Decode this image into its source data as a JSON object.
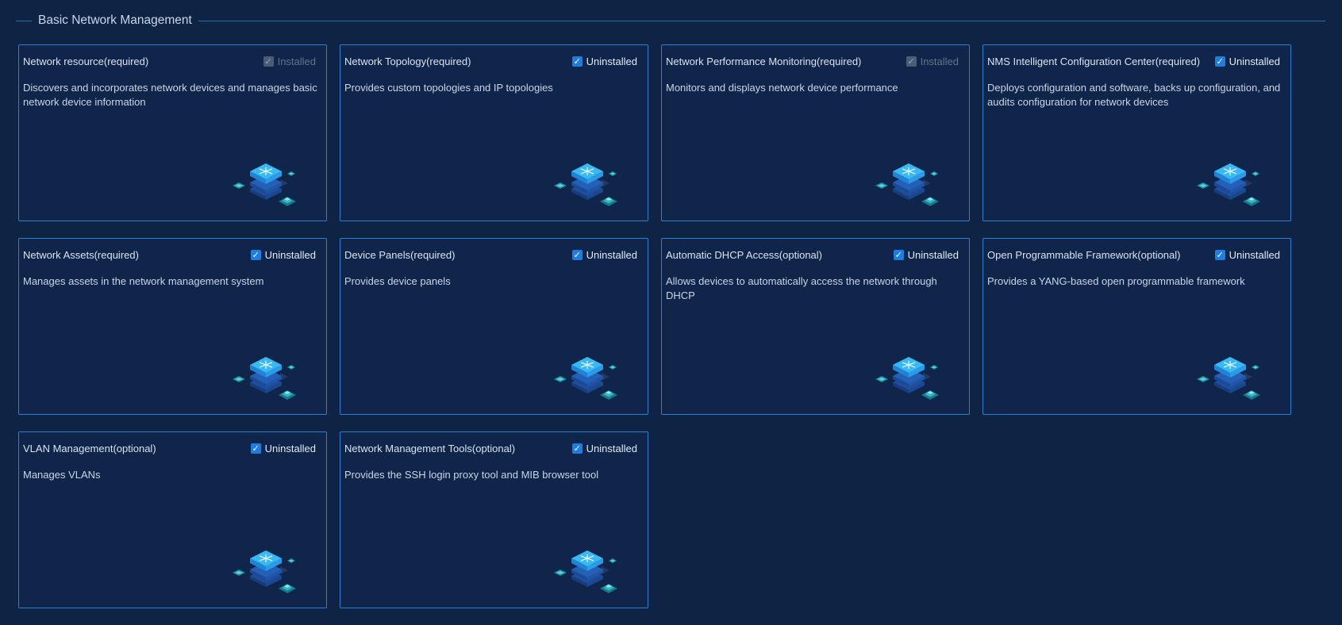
{
  "section": {
    "title": "Basic Network Management"
  },
  "icons": {
    "card_icon": "stacked-server-layers-icon",
    "checkbox": "checkmark-icon"
  },
  "colors": {
    "background": "#0f2444",
    "card_border": "#2f7fd0",
    "checkbox_active": "#1e7de0",
    "checkbox_disabled": "#4a5d78",
    "icon_top": "#29a8f0",
    "icon_accent": "#1f9aa8"
  },
  "cards": [
    {
      "name": "Network resource(required)",
      "status": "Installed",
      "checked": true,
      "disabled": true,
      "description": "Discovers and incorporates network devices and manages basic network device information"
    },
    {
      "name": "Network Topology(required)",
      "status": "Uninstalled",
      "checked": true,
      "disabled": false,
      "description": "Provides custom topologies and IP topologies"
    },
    {
      "name": "Network Performance Monitoring(required)",
      "status": "Installed",
      "checked": true,
      "disabled": true,
      "description": "Monitors and displays network device performance"
    },
    {
      "name": "NMS Intelligent Configuration Center(required)",
      "status": "Uninstalled",
      "checked": true,
      "disabled": false,
      "description": "Deploys configuration and software, backs up configuration, and audits configuration for network devices"
    },
    {
      "name": "Network Assets(required)",
      "status": "Uninstalled",
      "checked": true,
      "disabled": false,
      "description": "Manages assets in the network management system"
    },
    {
      "name": "Device Panels(required)",
      "status": "Uninstalled",
      "checked": true,
      "disabled": false,
      "description": "Provides device panels"
    },
    {
      "name": "Automatic DHCP Access(optional)",
      "status": "Uninstalled",
      "checked": true,
      "disabled": false,
      "description": "Allows devices to automatically access the network through DHCP"
    },
    {
      "name": "Open Programmable Framework(optional)",
      "status": "Uninstalled",
      "checked": true,
      "disabled": false,
      "description": "Provides a YANG-based open programmable framework"
    },
    {
      "name": "VLAN Management(optional)",
      "status": "Uninstalled",
      "checked": true,
      "disabled": false,
      "description": "Manages VLANs"
    },
    {
      "name": "Network Management Tools(optional)",
      "status": "Uninstalled",
      "checked": true,
      "disabled": false,
      "description": "Provides the SSH login proxy tool and MIB browser tool"
    }
  ]
}
